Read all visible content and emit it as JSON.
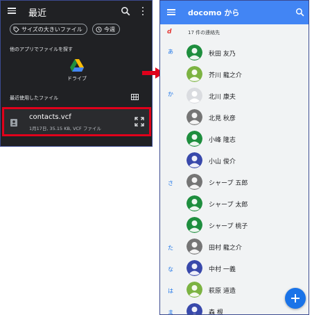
{
  "left_panel": {
    "title": "最近",
    "chips": [
      {
        "label": "サイズの大きいファイル",
        "icon": "tag-icon"
      },
      {
        "label": "今週",
        "icon": "clock-icon"
      }
    ],
    "other_apps_label": "他のアプリでファイルを探す",
    "drive_label": "ドライブ",
    "recent_files_label": "最近使用したファイル",
    "file": {
      "name": "contacts.vcf",
      "meta": "1月17日, 35.15 KB, VCF ファイル"
    },
    "highlight_color": "#e0001b"
  },
  "arrow": {
    "color": "#e0001b"
  },
  "right_panel": {
    "title": "docomo から",
    "accent_color": "#4285f4",
    "count_label": "17 件の連絡先",
    "index_letters": [
      {
        "label": "あ"
      },
      {
        "label": "か"
      },
      {
        "label": "さ"
      },
      {
        "label": "た"
      },
      {
        "label": "な"
      },
      {
        "label": "は"
      },
      {
        "label": "ま"
      }
    ],
    "contacts": [
      {
        "name": "秋田 友乃",
        "avatar_color": "#1e8e3e"
      },
      {
        "name": "芥川 龍之介",
        "avatar_color": "#7cb342"
      },
      {
        "name": "北川 康夫",
        "avatar_color": "#dadce0"
      },
      {
        "name": "北見 秋彦",
        "avatar_color": "#757575"
      },
      {
        "name": "小峰 隆志",
        "avatar_color": "#1e8e3e"
      },
      {
        "name": "小山 俊介",
        "avatar_color": "#3949ab"
      },
      {
        "name": "シャープ 五郎",
        "avatar_color": "#757575"
      },
      {
        "name": "シャープ 太郎",
        "avatar_color": "#1e8e3e"
      },
      {
        "name": "シャープ 桃子",
        "avatar_color": "#1e8e3e"
      },
      {
        "name": "田村 龍之介",
        "avatar_color": "#757575"
      },
      {
        "name": "中村 一義",
        "avatar_color": "#3949ab"
      },
      {
        "name": "萩原 道造",
        "avatar_color": "#7cb342"
      },
      {
        "name": "森 根",
        "avatar_color": "#3949ab"
      }
    ]
  }
}
